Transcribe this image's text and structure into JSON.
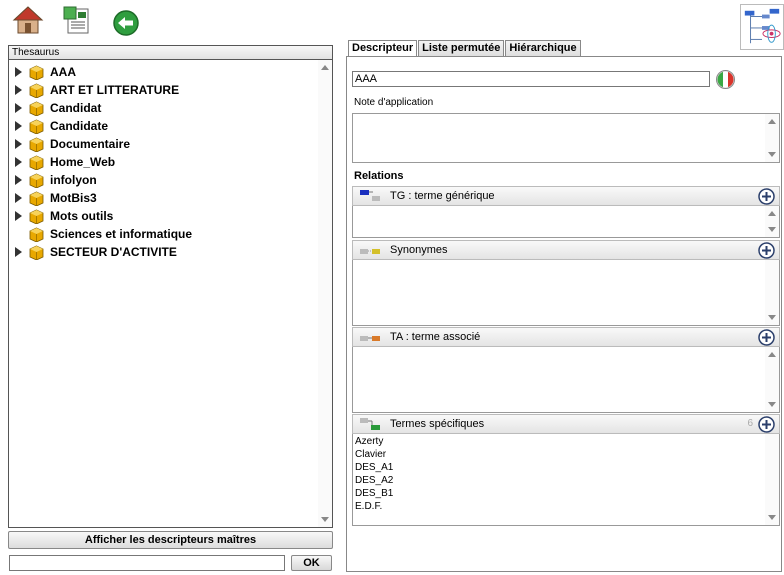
{
  "toolbar": {
    "home_icon": "home-icon",
    "list_icon": "document-list-icon",
    "back_icon": "back-arrow-icon",
    "logo_icon": "thesaurus-network-logo"
  },
  "left_panel": {
    "header": "Thesaurus",
    "tree": [
      {
        "label": "AAA",
        "expandable": true
      },
      {
        "label": "ART ET LITTERATURE",
        "expandable": true
      },
      {
        "label": "Candidat",
        "expandable": true
      },
      {
        "label": "Candidate",
        "expandable": true
      },
      {
        "label": "Documentaire",
        "expandable": true
      },
      {
        "label": "Home_Web",
        "expandable": true
      },
      {
        "label": "infolyon",
        "expandable": true
      },
      {
        "label": "MotBis3",
        "expandable": true
      },
      {
        "label": "Mots outils",
        "expandable": true
      },
      {
        "label": "Sciences et informatique",
        "expandable": false
      },
      {
        "label": "SECTEUR D'ACTIVITE",
        "expandable": true
      }
    ],
    "master_button": "Afficher les descripteurs maîtres",
    "search_value": "",
    "ok_button": "OK"
  },
  "tabs": [
    {
      "label": "Descripteur",
      "active": true
    },
    {
      "label": "Liste permutée",
      "active": false
    },
    {
      "label": "Hiérarchique",
      "active": false
    }
  ],
  "descriptor": {
    "term_value": "AAA",
    "language_icon": "italian-flag-icon",
    "note_label": "Note d'application",
    "note_value": "",
    "relations_label": "Relations"
  },
  "relations": {
    "generic": {
      "title": "TG : terme générique",
      "icon": "generic-term-icon"
    },
    "synonyms": {
      "title": "Synonymes",
      "icon": "synonym-icon"
    },
    "associated": {
      "title": "TA : terme associé",
      "icon": "associated-term-icon"
    },
    "specific": {
      "title": "Termes spécifiques",
      "icon": "specific-term-icon",
      "count": "6",
      "items": [
        "Azerty",
        "Clavier",
        "DES_A1",
        "DES_A2",
        "DES_B1",
        "E.D.F."
      ]
    }
  },
  "colors": {
    "folder": "#e8a800",
    "toggle": "#333333",
    "add_button": "#2b3f6b",
    "back_button": "#2f9e3f"
  }
}
